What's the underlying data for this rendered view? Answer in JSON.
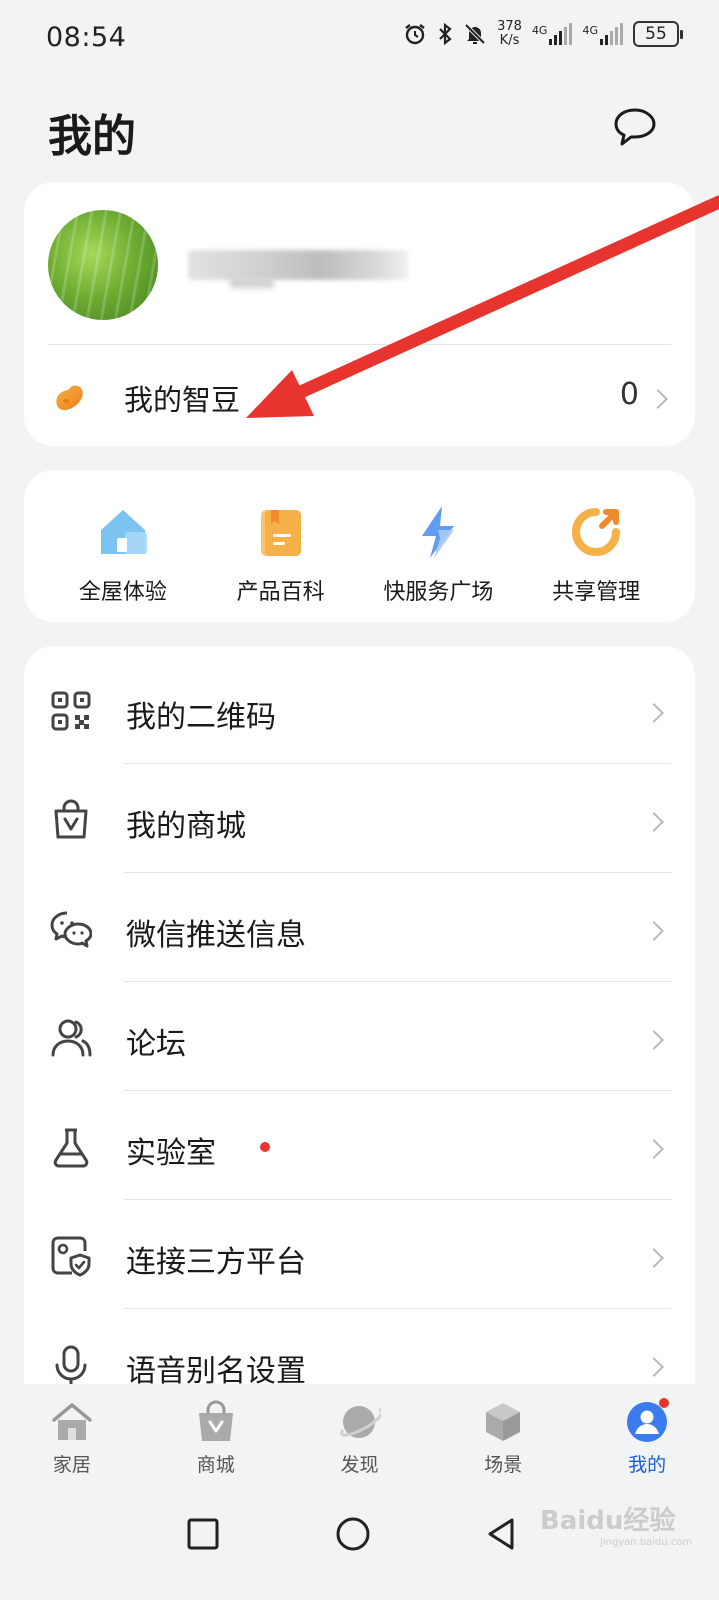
{
  "status_bar": {
    "time": "08:54",
    "speed_value": "378",
    "speed_unit": "K/s",
    "network_1": "4G",
    "network_2": "4G",
    "battery": "55"
  },
  "header": {
    "title": "我的"
  },
  "profile": {
    "beans_label": "我的智豆",
    "beans_count": "0"
  },
  "quick_actions": [
    {
      "label": "全屋体验",
      "icon": "home-icon"
    },
    {
      "label": "产品百科",
      "icon": "book-icon"
    },
    {
      "label": "快服务广场",
      "icon": "lightning-icon"
    },
    {
      "label": "共享管理",
      "icon": "share-icon"
    }
  ],
  "menu": [
    {
      "label": "我的二维码",
      "icon": "qrcode-icon"
    },
    {
      "label": "我的商城",
      "icon": "shopping-bag-icon"
    },
    {
      "label": "微信推送信息",
      "icon": "wechat-icon"
    },
    {
      "label": "论坛",
      "icon": "people-icon"
    },
    {
      "label": "实验室",
      "icon": "flask-icon",
      "badge": true
    },
    {
      "label": "连接三方平台",
      "icon": "shield-link-icon"
    },
    {
      "label": "语音别名设置",
      "icon": "microphone-icon"
    }
  ],
  "tabs": [
    {
      "label": "家居",
      "icon": "home-tab-icon"
    },
    {
      "label": "商城",
      "icon": "mall-tab-icon"
    },
    {
      "label": "发现",
      "icon": "planet-tab-icon"
    },
    {
      "label": "场景",
      "icon": "cube-tab-icon"
    },
    {
      "label": "我的",
      "icon": "person-tab-icon",
      "active": true
    }
  ],
  "colors": {
    "accent": "#1a5fd8",
    "badge": "#e8342f",
    "annotation_arrow": "#e8342f"
  },
  "watermark": {
    "text": "Baidu经验",
    "sub": "jingyan.baidu.com"
  }
}
